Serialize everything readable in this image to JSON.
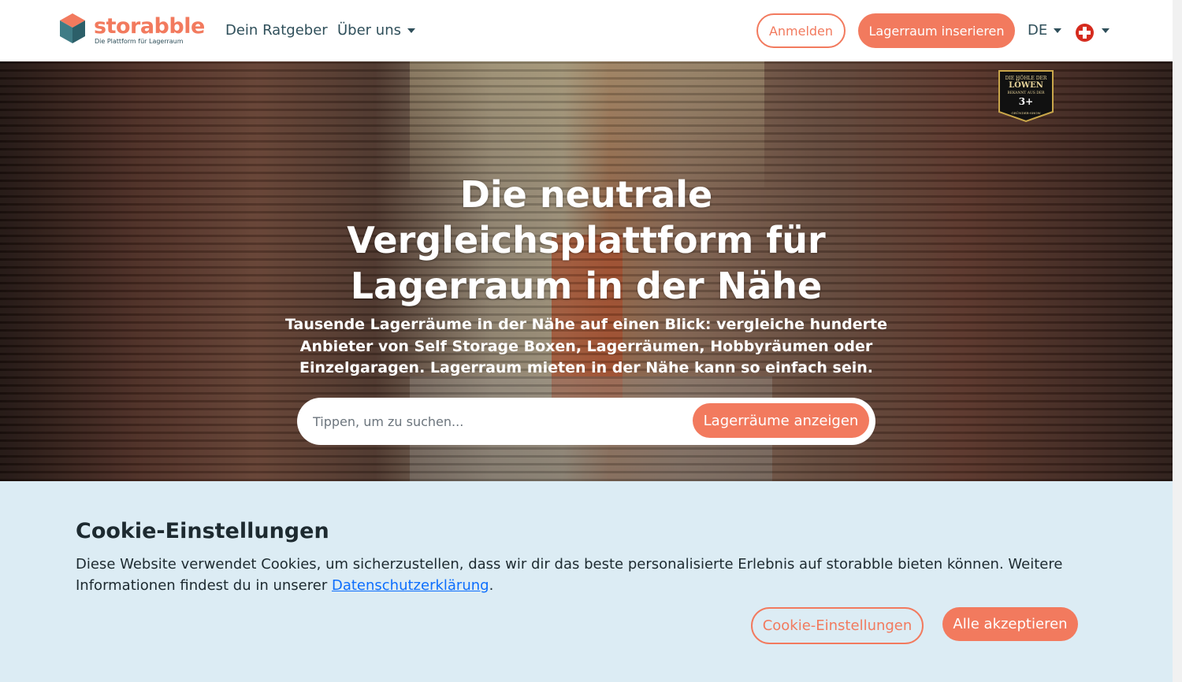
{
  "header": {
    "logo_word": "storabble",
    "logo_tagline": "Die Plattform für Lagerraum",
    "nav": [
      {
        "label": "Dein Ratgeber"
      },
      {
        "label": "Über uns"
      }
    ],
    "login_label": "Anmelden",
    "list_space_label": "Lagerraum inserieren",
    "language": "DE",
    "flag_icon": "swiss-flag-icon"
  },
  "hero": {
    "badge": {
      "line1": "DIE HÖHLE DER",
      "line2": "LÖWEN",
      "line3": "BEKANNT AUS DER",
      "line4": "3+",
      "line5": "GRÜNDER-SHOW"
    },
    "title": "Die neutrale Vergleichsplattform für Lagerraum in der Nähe",
    "subtitle": "Tausende Lagerräume in der Nähe auf einen Blick: vergleiche hunderte Anbieter von Self Storage Boxen, Lagerräumen, Hobbyräumen oder Einzelgaragen. Lagerraum mieten in der Nähe kann so einfach sein.",
    "search_placeholder": "Tippen, um zu suchen...",
    "search_button": "Lagerräume anzeigen"
  },
  "cookie": {
    "title": "Cookie-Einstellungen",
    "text_before": "Diese Website verwendet Cookies, um sicherzustellen, dass wir dir das beste personalisierte Erlebnis auf storabble bieten können. Weitere Informationen findest du in unserer ",
    "link_label": "Datenschutzerklärung",
    "text_after": ".",
    "settings_button": "Cookie-Einstellungen",
    "accept_button": "Alle akzeptieren"
  },
  "colors": {
    "accent": "#f27a5e",
    "text_dark": "#2f4f5a",
    "cookie_bg": "#dcecf4"
  }
}
